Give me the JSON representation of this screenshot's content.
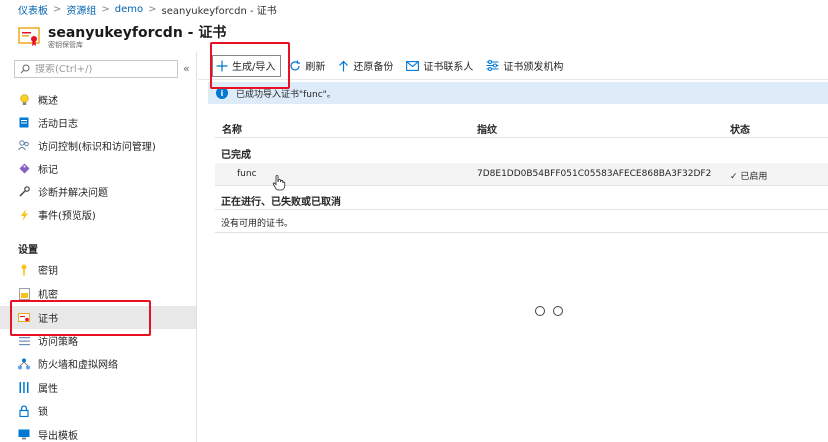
{
  "breadcrumb": [
    "仪表板",
    "资源组",
    "demo",
    "seanyukeyforcdn - 证书"
  ],
  "header": {
    "title": "seanyukeyforcdn - 证书",
    "subtitle": "密钥保管库"
  },
  "sidebar": {
    "search_placeholder": "搜索(Ctrl+/)",
    "collapse": "«",
    "items": [
      {
        "label": "概述",
        "icon": "lightbulb-icon"
      },
      {
        "label": "活动日志",
        "icon": "log-icon"
      },
      {
        "label": "访问控制(标识和访问管理)",
        "icon": "people-icon"
      },
      {
        "label": "标记",
        "icon": "tag-icon"
      },
      {
        "label": "诊断并解决问题",
        "icon": "wrench-icon"
      },
      {
        "label": "事件(预览版)",
        "icon": "lightning-icon"
      }
    ],
    "settings_label": "设置",
    "settings_items": [
      {
        "label": "密钥",
        "icon": "key-icon"
      },
      {
        "label": "机密",
        "icon": "secret-icon"
      },
      {
        "label": "证书",
        "icon": "certificate-icon"
      },
      {
        "label": "访问策略",
        "icon": "policy-icon"
      },
      {
        "label": "防火墙和虚拟网络",
        "icon": "network-icon"
      },
      {
        "label": "属性",
        "icon": "properties-icon"
      },
      {
        "label": "锁",
        "icon": "lock-icon"
      },
      {
        "label": "导出模板",
        "icon": "template-icon"
      }
    ]
  },
  "toolbar": {
    "generate_import": "生成/导入",
    "refresh": "刷新",
    "restore_backup": "还原备份",
    "contacts": "证书联系人",
    "issuers": "证书颁发机构"
  },
  "banner": {
    "text": "已成功导入证书\"func\"。"
  },
  "table": {
    "columns": [
      "名称",
      "指纹",
      "状态"
    ],
    "completed_label": "已完成",
    "rows": [
      {
        "name": "func",
        "thumbprint": "7D8E1DD0B54BFF051C05583AFECE868BA3F32DF2",
        "status": "✓ 已启用"
      }
    ],
    "in_progress_label": "正在进行、已失败或已取消",
    "empty_text": "没有可用的证书。"
  },
  "colors": {
    "accent": "#0078d4",
    "highlight_box": "#e81123",
    "banner_bg": "#deecf9"
  }
}
